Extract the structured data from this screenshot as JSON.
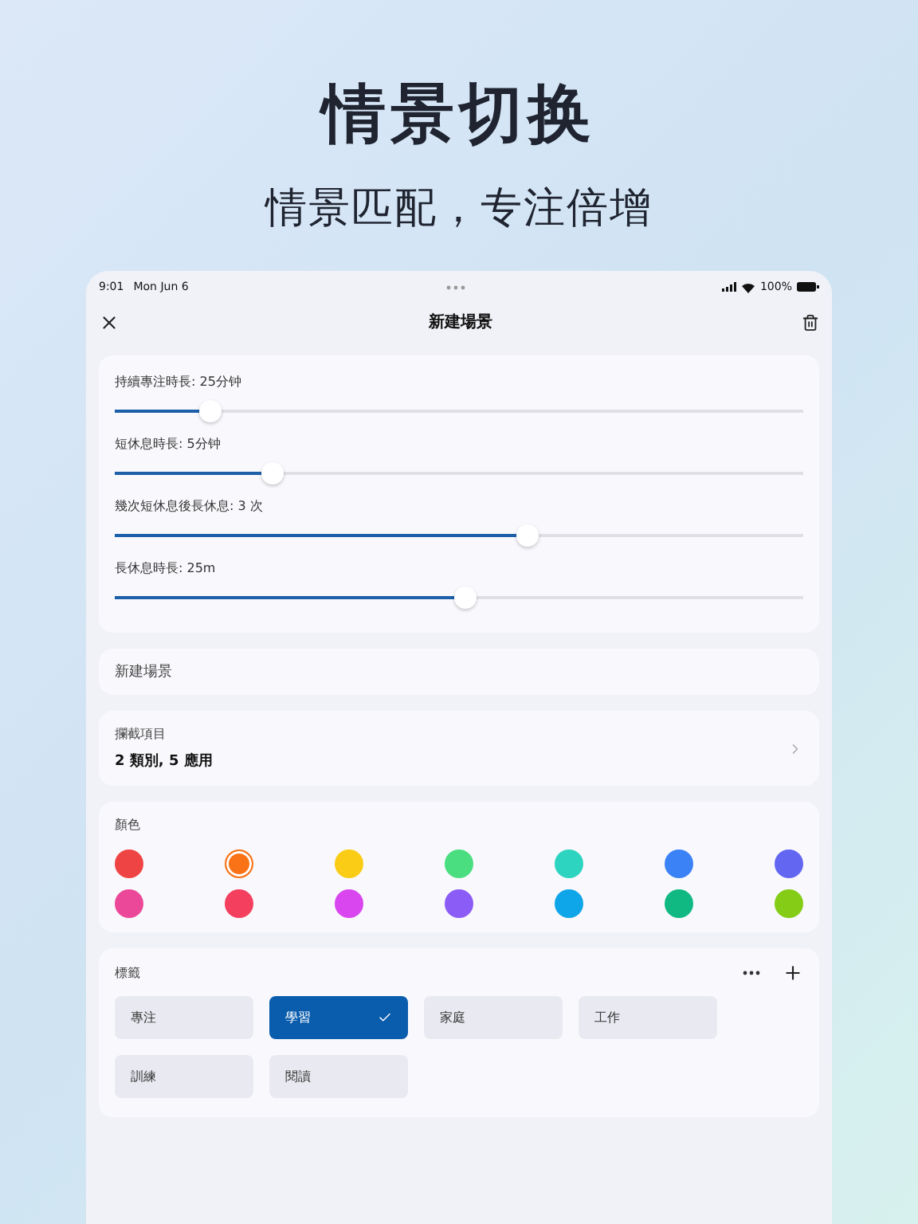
{
  "hero": {
    "title": "情景切换",
    "subtitle": "情景匹配，专注倍增"
  },
  "status_bar": {
    "time": "9:01",
    "date": "Mon Jun 6",
    "battery": "100%"
  },
  "nav": {
    "title": "新建場景"
  },
  "sliders": [
    {
      "label": "持續專注時長: 25分钟",
      "level": 0.14
    },
    {
      "label": "短休息時長: 5分钟",
      "level": 0.23
    },
    {
      "label": "幾次短休息後長休息: 3 次",
      "level": 0.6
    },
    {
      "label": "長休息時長: 25m",
      "level": 0.51
    }
  ],
  "name_field": {
    "value": "新建場景"
  },
  "blocked": {
    "label": "攔截項目",
    "value": "2 類別, 5 應用"
  },
  "colors": {
    "label": "顏色",
    "items": [
      {
        "color": "#ef4444",
        "selected": false
      },
      {
        "color": "#f97316",
        "selected": true
      },
      {
        "color": "#facc15",
        "selected": false
      },
      {
        "color": "#4ade80",
        "selected": false
      },
      {
        "color": "#2dd4bf",
        "selected": false
      },
      {
        "color": "#3b82f6",
        "selected": false
      },
      {
        "color": "#6366f1",
        "selected": false
      },
      {
        "color": "#ec4899",
        "selected": false
      },
      {
        "color": "#f43f5e",
        "selected": false
      },
      {
        "color": "#d946ef",
        "selected": false
      },
      {
        "color": "#8b5cf6",
        "selected": false
      },
      {
        "color": "#0ea5e9",
        "selected": false
      },
      {
        "color": "#10b981",
        "selected": false
      },
      {
        "color": "#84cc16",
        "selected": false
      }
    ]
  },
  "tags": {
    "label": "標籤",
    "items": [
      {
        "label": "專注",
        "selected": false
      },
      {
        "label": "學習",
        "selected": true
      },
      {
        "label": "家庭",
        "selected": false
      },
      {
        "label": "工作",
        "selected": false
      },
      {
        "label": "訓練",
        "selected": false
      },
      {
        "label": "閱讀",
        "selected": false
      }
    ]
  }
}
